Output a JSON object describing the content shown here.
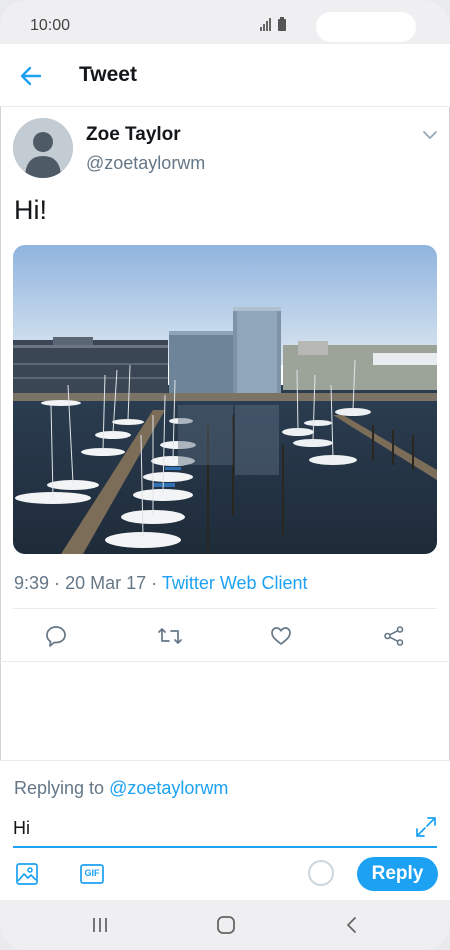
{
  "status_bar": {
    "time": "10:00",
    "icons": [
      "signal-icon",
      "battery-icon"
    ]
  },
  "header": {
    "title": "Tweet",
    "back_icon": "arrow-left-icon"
  },
  "tweet": {
    "author_name": "Zoe Taylor",
    "author_handle": "@zoetaylorwm",
    "text": "Hi!",
    "time": "9:39",
    "date": "20 Mar 17",
    "separator": "·",
    "client": "Twitter Web Client",
    "media_description_icon": "harbor-photo"
  },
  "actions": [
    "reply-icon",
    "retweet-icon",
    "like-icon",
    "share-icon"
  ],
  "composer": {
    "replying_prefix": "Replying to",
    "replying_to": "@zoetaylorwm",
    "input_value": "Hi",
    "reply_label": "Reply",
    "tools": [
      "image-icon",
      "gif-icon"
    ],
    "gif_label": "GIF"
  },
  "nav": [
    "recent-apps-icon",
    "home-icon",
    "back-icon"
  ],
  "colors": {
    "accent": "#1da1f2",
    "secondary_text": "#657786",
    "primary_text": "#14171a"
  }
}
